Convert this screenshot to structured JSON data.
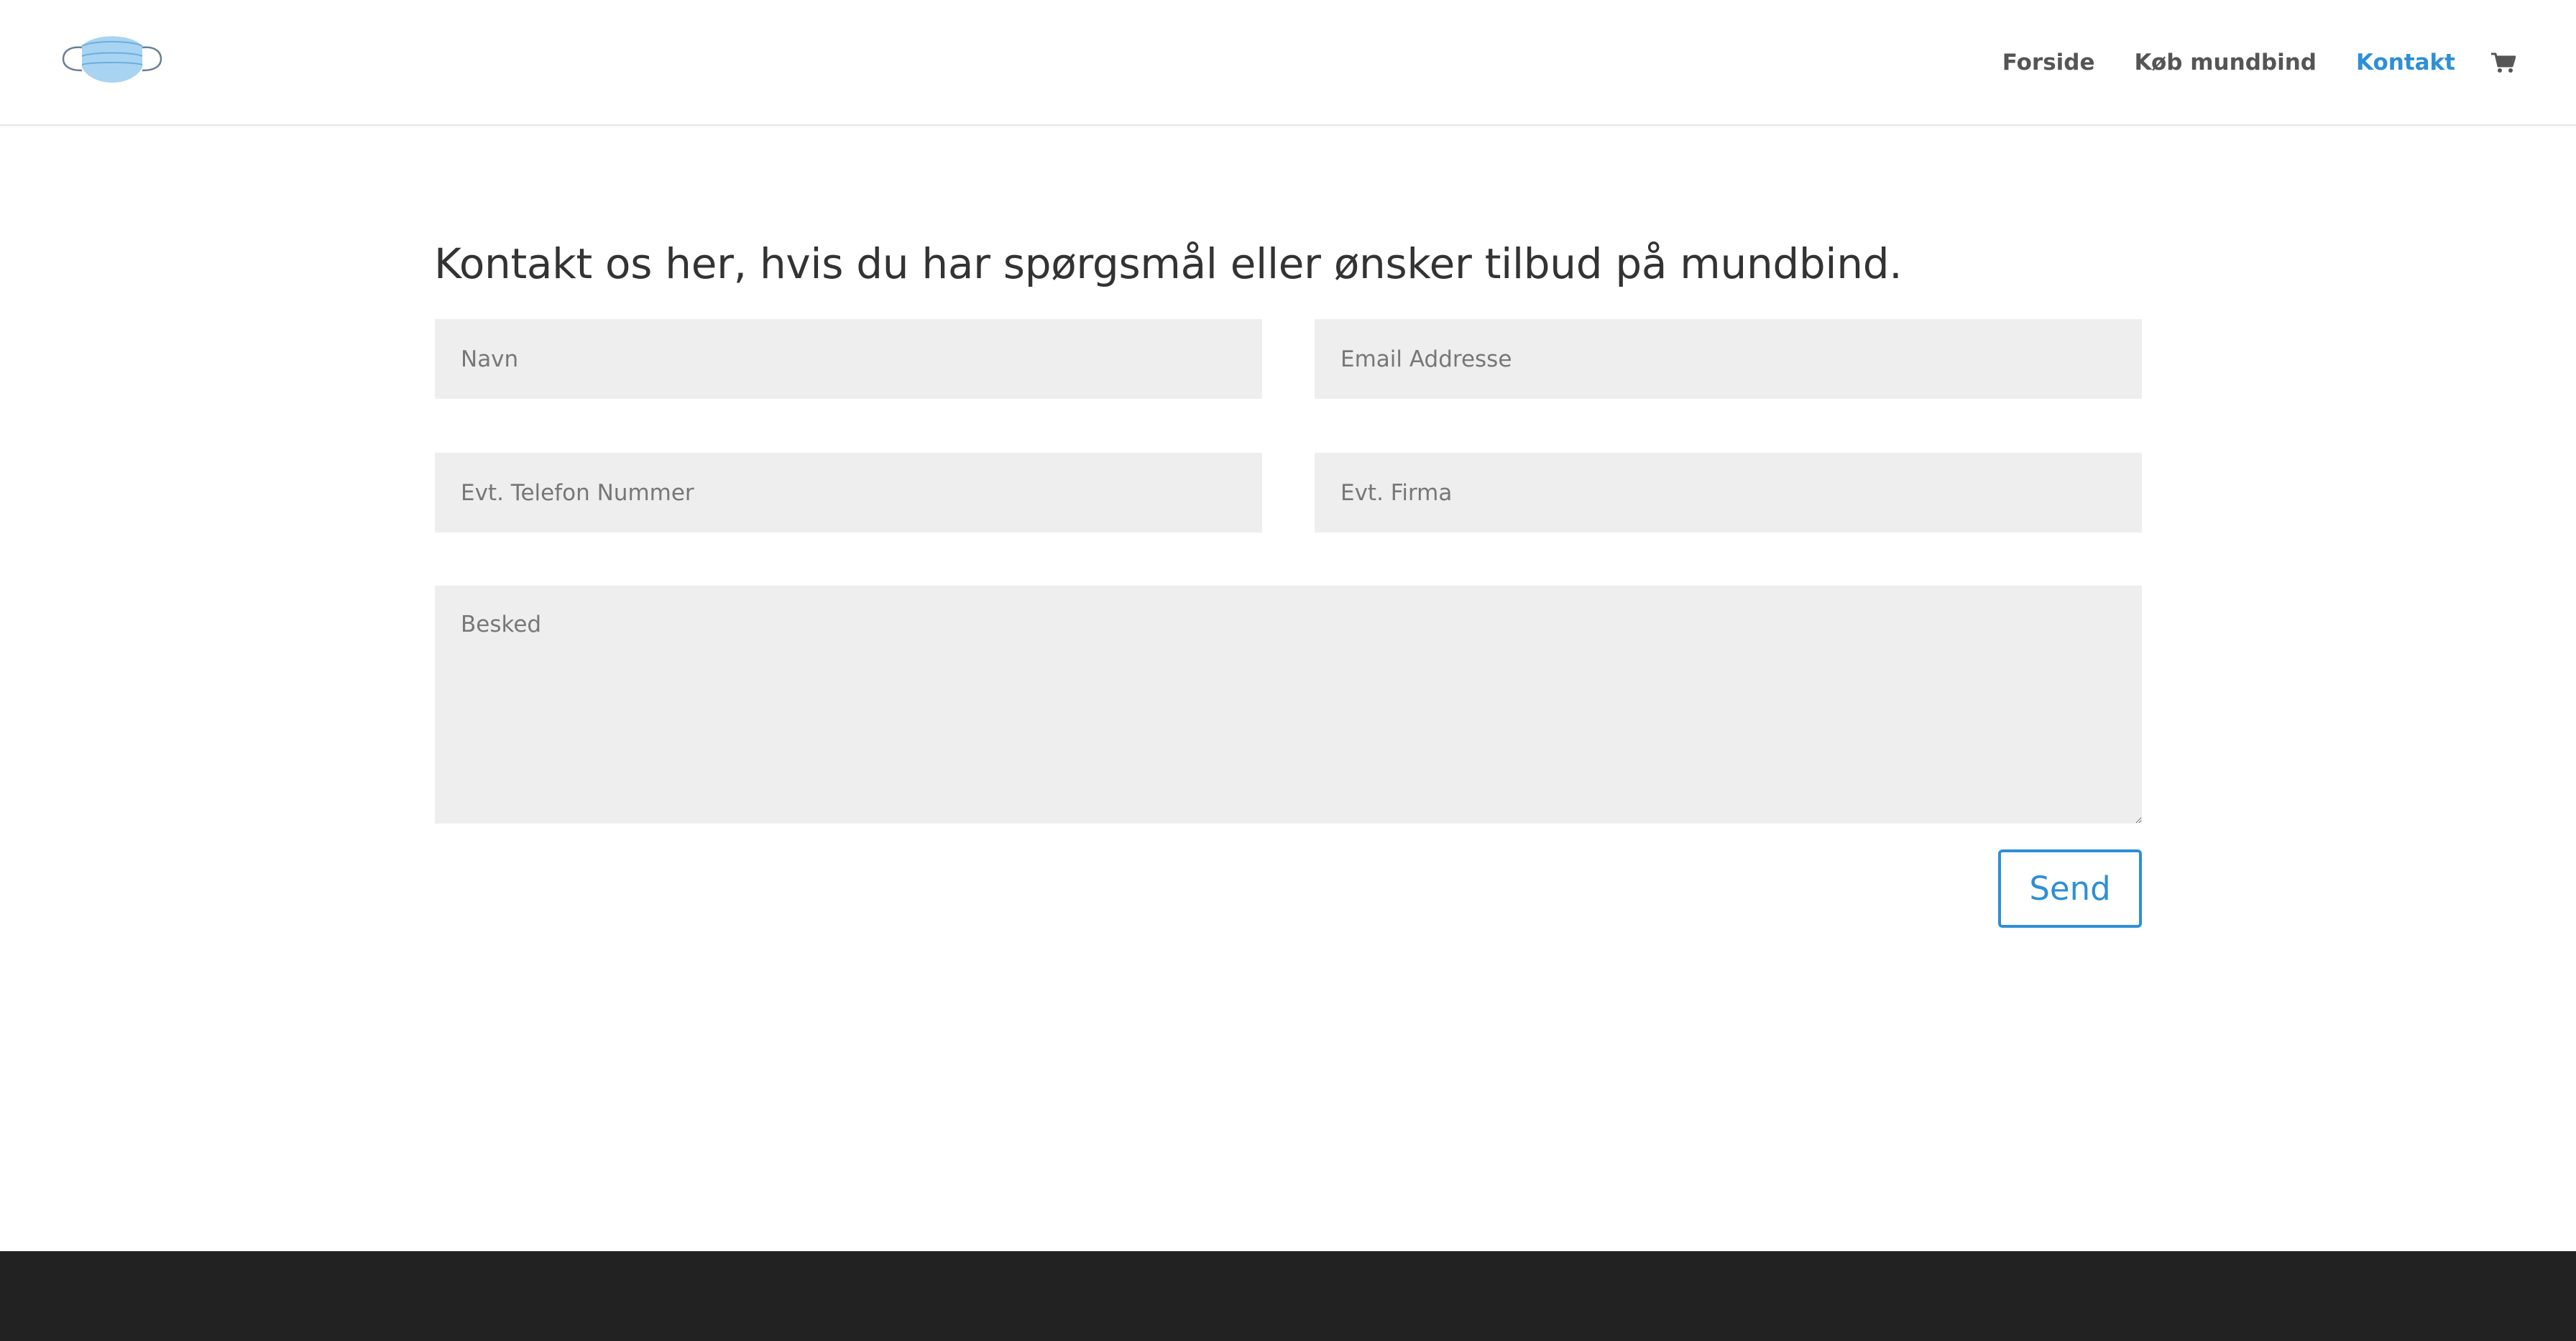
{
  "header": {
    "logo_icon": "face-mask-icon",
    "nav": [
      {
        "label": "Forside",
        "active": false
      },
      {
        "label": "Køb mundbind",
        "active": false
      },
      {
        "label": "Kontakt",
        "active": true
      }
    ],
    "cart_icon": "shopping-cart-icon"
  },
  "contact": {
    "title": "Kontakt os her, hvis du har spørgsmål eller ønsker tilbud på mundbind.",
    "fields": {
      "name": {
        "placeholder": "Navn",
        "value": ""
      },
      "email": {
        "placeholder": "Email Addresse",
        "value": ""
      },
      "phone": {
        "placeholder": "Evt. Telefon Nummer",
        "value": ""
      },
      "company": {
        "placeholder": "Evt. Firma",
        "value": ""
      },
      "message": {
        "placeholder": "Besked",
        "value": ""
      }
    },
    "submit_label": "Send"
  },
  "colors": {
    "accent": "#2e8fd6",
    "nav_text": "#555555",
    "field_bg": "#eeeeee",
    "footer_bg": "#222222"
  }
}
